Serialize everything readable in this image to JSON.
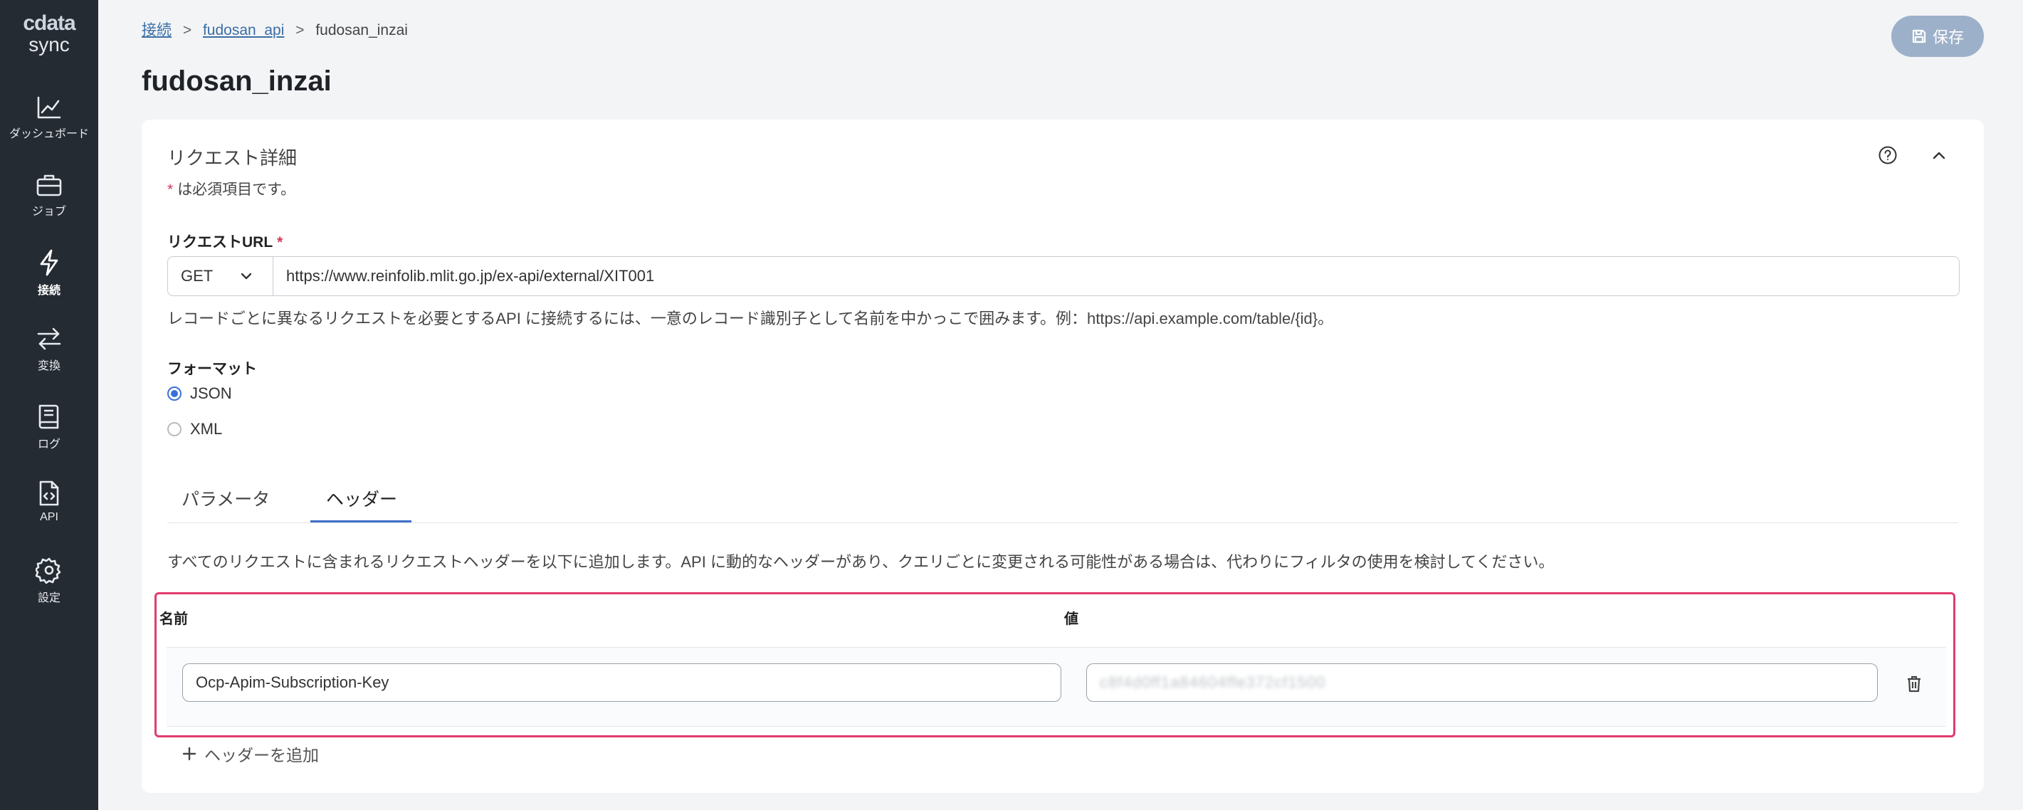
{
  "sidebar": {
    "logo_top": "cdata",
    "logo_bottom": "sync",
    "items": [
      {
        "label": "ダッシュボード",
        "icon": "chart-line-icon"
      },
      {
        "label": "ジョブ",
        "icon": "briefcase-icon"
      },
      {
        "label": "接続",
        "icon": "lightning-icon",
        "active": true
      },
      {
        "label": "変換",
        "icon": "arrows-exchange-icon"
      },
      {
        "label": "ログ",
        "icon": "book-icon"
      },
      {
        "label": "API",
        "icon": "code-file-icon"
      },
      {
        "label": "設定",
        "icon": "gear-icon"
      }
    ]
  },
  "breadcrumb": {
    "items": [
      "接続",
      "fudosan_api",
      "fudosan_inzai"
    ],
    "separator": ">"
  },
  "page_title": "fudosan_inzai",
  "toolbar": {
    "save_label": "保存"
  },
  "request_details": {
    "title": "リクエスト詳細",
    "required_star": "*",
    "required_note": "は必須項目です。",
    "url_label": "リクエストURL",
    "method": "GET",
    "url": "https://www.reinfolib.mlit.go.jp/ex-api/external/XIT001",
    "url_help": "レコードごとに異なるリクエストを必要とするAPI に接続するには、一意のレコード識別子として名前を中かっこで囲みます。例：https://api.example.com/table/{id}。",
    "format_label": "フォーマット",
    "formats": [
      {
        "label": "JSON",
        "checked": true
      },
      {
        "label": "XML",
        "checked": false
      }
    ]
  },
  "tabs": [
    {
      "label": "パラメータ",
      "active": false
    },
    {
      "label": "ヘッダー",
      "active": true
    }
  ],
  "headers": {
    "description": "すべてのリクエストに含まれるリクエストヘッダーを以下に追加します。API に動的なヘッダーがあり、クエリごとに変更される可能性がある場合は、代わりにフィルタの使用を検討してください。",
    "name_col": "名前",
    "value_col": "値",
    "rows": [
      {
        "name": "Ocp-Apim-Subscription-Key",
        "value": "c8f4d0ff1a84604ffe372cf1500"
      }
    ],
    "add_label": "ヘッダーを追加"
  },
  "colors": {
    "sidebar_bg": "#252b33",
    "accent": "#3b6fd8",
    "highlight": "#e23b6e",
    "save_button": "#9db0c9"
  }
}
